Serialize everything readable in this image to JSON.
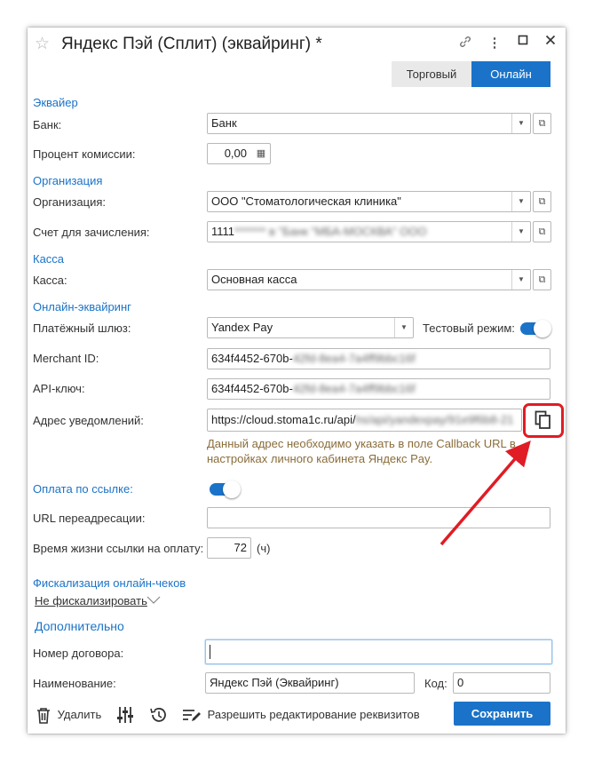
{
  "window": {
    "title": "Яндекс Пэй (Сплит) (эквайринг) *",
    "tabs": [
      "Торговый",
      "Онлайн"
    ],
    "active_tab": "Онлайн"
  },
  "sections": {
    "acquirer": "Эквайер",
    "organization": "Организация",
    "cashbox": "Касса",
    "online": "Онлайн-эквайринг",
    "fiscal": "Фискализация онлайн-чеков",
    "extra": "Дополнительно"
  },
  "fields": {
    "bank": {
      "label": "Банк:",
      "value": "Банк"
    },
    "commission": {
      "label": "Процент комиссии:",
      "value": "0,00"
    },
    "org": {
      "label": "Организация:",
      "value": "ООО \"Стоматологическая клиника\""
    },
    "account": {
      "label": "Счет для зачисления:",
      "value": "1111",
      "blurred": "******* в \"Банк \"МБА-МОСКВА\" ООО"
    },
    "cashbox": {
      "label": "Касса:",
      "value": "Основная касса"
    },
    "gateway": {
      "label": "Платёжный шлюз:",
      "value": "Yandex Pay"
    },
    "test_mode": {
      "label": "Тестовый режим:",
      "on": true
    },
    "merchant": {
      "label": "Merchant ID:",
      "value": "634f4452-670b-",
      "blurred": "42fd-8ea4-7a4ff9bbc16f"
    },
    "apikey": {
      "label": "API-ключ:",
      "value": "634f4452-670b-",
      "blurred": "42fd-8ea4-7a4ff9bbc16f"
    },
    "notify": {
      "label": "Адрес уведомлений:",
      "value": "https://cloud.stoma1c.ru/api/",
      "blurred": "hs/api/yandexpay/91e9f6b8-21"
    },
    "notify_hint": "Данный адрес необходимо указать в поле Callback URL в настройках личного кабинета Яндекс Pay.",
    "pay_link": {
      "label": "Оплата по ссылке:",
      "on": true
    },
    "redirect": {
      "label": "URL переадресации:",
      "value": ""
    },
    "link_ttl": {
      "label": "Время жизни ссылки на оплату:",
      "value": "72",
      "unit": "(ч)"
    },
    "fiscal_link": "Не фискализировать",
    "contract": {
      "label": "Номер договора:",
      "value": ""
    },
    "name": {
      "label": "Наименование:",
      "value": "Яндекс Пэй (Эквайринг)"
    },
    "code": {
      "label": "Код:",
      "value": "0"
    }
  },
  "toolbar": {
    "delete": "Удалить",
    "allow_edit": "Разрешить редактирование реквизитов",
    "save": "Сохранить"
  },
  "icons": {
    "star": "star-icon",
    "link": "link-icon",
    "more": "more-vertical-icon",
    "maximize": "maximize-icon",
    "close": "close-icon",
    "calculator": "calculator-icon",
    "copy": "copy-icon",
    "trash": "trash-icon",
    "settings": "sliders-icon",
    "history": "history-icon",
    "edit": "edit-list-icon"
  },
  "colors": {
    "accent": "#1a73c8",
    "highlight": "#e01c24",
    "hint": "#8a6d3b"
  }
}
